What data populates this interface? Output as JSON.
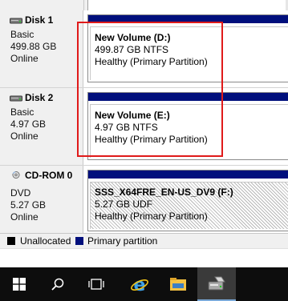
{
  "disks": [
    {
      "name": "Disk 1",
      "type": "Basic",
      "size": "499.88 GB",
      "status": "Online",
      "icon": "hard-disk-icon",
      "volume": {
        "title": "New Volume  (D:)",
        "size_fs": "499.87 GB NTFS",
        "health": "Healthy (Primary Partition)"
      }
    },
    {
      "name": "Disk 2",
      "type": "Basic",
      "size": "4.97 GB",
      "status": "Online",
      "icon": "hard-disk-icon",
      "volume": {
        "title": "New Volume  (E:)",
        "size_fs": "4.97 GB NTFS",
        "health": "Healthy (Primary Partition)"
      }
    },
    {
      "name": "CD-ROM 0",
      "type": "DVD",
      "size": "5.27 GB",
      "status": "Online",
      "icon": "cd-rom-icon",
      "volume": {
        "title": "SSS_X64FRE_EN-US_DV9  (F:)",
        "size_fs": "5.27 GB UDF",
        "health": "Healthy (Primary Partition)"
      }
    }
  ],
  "legend": {
    "unallocated": "Unallocated",
    "primary": "Primary partition"
  },
  "colors": {
    "primary_partition": "#000f7c",
    "unallocated": "#000000",
    "highlight": "#e01a1a",
    "taskbar": "#0d0d0d"
  },
  "taskbar": {
    "icons": [
      "start-windows-icon",
      "search-icon",
      "task-view-icon",
      "internet-explorer-icon",
      "file-explorer-icon",
      "disk-management-icon"
    ]
  }
}
